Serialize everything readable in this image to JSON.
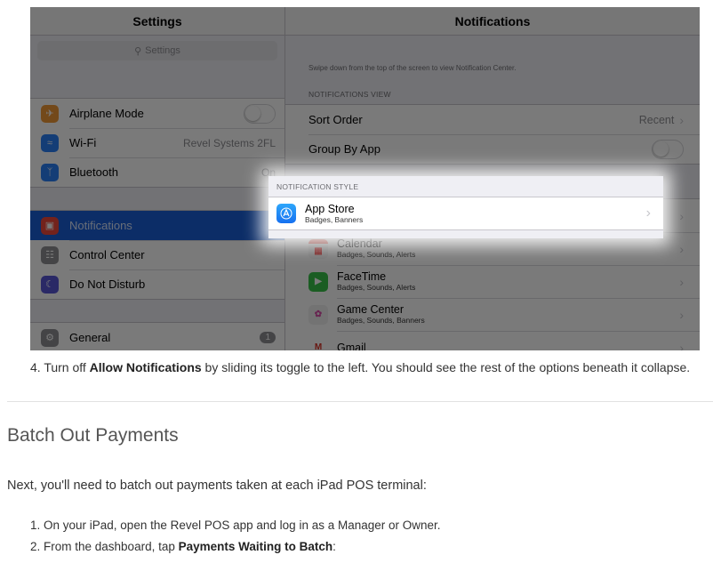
{
  "screenshot": {
    "left_pane": {
      "title": "Settings",
      "search_placeholder": "Settings",
      "group1": [
        {
          "label": "Airplane Mode",
          "icon": "airplane-icon",
          "color": "#f09a37",
          "control": "toggle"
        },
        {
          "label": "Wi-Fi",
          "icon": "wifi-icon",
          "color": "#2b7ff7",
          "value": "Revel Systems 2FL"
        },
        {
          "label": "Bluetooth",
          "icon": "bluetooth-icon",
          "color": "#2b7ff7",
          "value": "On"
        }
      ],
      "group2": [
        {
          "label": "Notifications",
          "icon": "notifications-icon",
          "color": "#f0473c",
          "selected": true
        },
        {
          "label": "Control Center",
          "icon": "control-center-icon",
          "color": "#8e8e93"
        },
        {
          "label": "Do Not Disturb",
          "icon": "moon-icon",
          "color": "#5856d6"
        }
      ],
      "group3": [
        {
          "label": "General",
          "icon": "gear-icon",
          "color": "#8e8e93",
          "badge": "1"
        }
      ]
    },
    "right_pane": {
      "title": "Notifications",
      "hint": "Swipe down from the top of the screen to view Notification Center.",
      "view_header": "NOTIFICATIONS VIEW",
      "sort_order_label": "Sort Order",
      "sort_order_value": "Recent",
      "group_by_app_label": "Group By App",
      "style_header": "NOTIFICATION STYLE",
      "apps": [
        {
          "name": "App Store",
          "sub": "Badges, Banners",
          "icon": "app-store-icon",
          "color": "#1d8cf8",
          "highlighted": true
        },
        {
          "name": "Calendar",
          "sub": "Badges, Sounds, Alerts",
          "icon": "calendar-icon",
          "color": "#f4f4f4"
        },
        {
          "name": "FaceTime",
          "sub": "Badges, Sounds, Alerts",
          "icon": "facetime-icon",
          "color": "#3ac24a"
        },
        {
          "name": "Game Center",
          "sub": "Badges, Sounds, Banners",
          "icon": "game-center-icon",
          "color": "#f0f0f0"
        },
        {
          "name": "Gmail",
          "sub": "",
          "icon": "gmail-icon",
          "color": "#ffffff"
        }
      ]
    }
  },
  "article": {
    "step4_prefix": "4. Turn off ",
    "step4_bold": "Allow Notifications",
    "step4_suffix": " by sliding its toggle to the left. You should see the rest of the options beneath it collapse.",
    "heading": "Batch Out Payments",
    "intro": "Next, you'll need to batch out payments taken at each iPad POS terminal:",
    "step1": "1. On your iPad, open the Revel POS app and log in as a Manager or Owner.",
    "step2_prefix": "2. From the dashboard, tap ",
    "step2_bold": "Payments Waiting to Batch",
    "step2_suffix": ":"
  }
}
